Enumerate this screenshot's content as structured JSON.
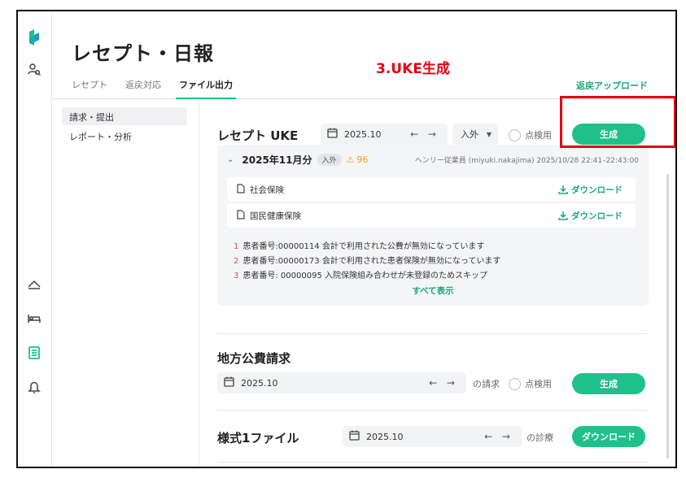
{
  "header": {
    "title": "レセプト・日報",
    "annotation": "3.UKE生成",
    "tabs": [
      {
        "label": "レセプト"
      },
      {
        "label": "返戻対応"
      },
      {
        "label": "ファイル出力"
      }
    ],
    "return_upload": "返戻アップロード"
  },
  "subnav": [
    {
      "label": "請求・提出"
    },
    {
      "label": "レポート・分析"
    }
  ],
  "uke": {
    "title": "レセプト UKE",
    "date": "2025.10",
    "arrows": "← →",
    "type_select": "入外",
    "check_label": "点検用",
    "generate": "生成",
    "panel": {
      "month": "2025年11月分",
      "badge": "入外",
      "warn_count": "96",
      "user": "ヘンリー従業員 (miyuki.nakajima)  2025/10/28 22:41–22:43:00",
      "files": [
        {
          "name": "社会保険",
          "download": "ダウンロード"
        },
        {
          "name": "国民健康保険",
          "download": "ダウンロード"
        }
      ],
      "messages": [
        {
          "num": "1",
          "text": "患者番号:00000114 会計で利用された公費が無効になっています"
        },
        {
          "num": "2",
          "text": "患者番号:00000173 会計で利用された患者保険が無効になっています"
        },
        {
          "num": "3",
          "text": "患者番号: 00000095 入院保険組み合わせが未登録のためスキップ"
        }
      ],
      "show_all": "すべて表示"
    }
  },
  "local": {
    "title": "地方公費請求",
    "date": "2025.10",
    "arrows": "← →",
    "suffix": "の請求",
    "check_label": "点検用",
    "generate": "生成"
  },
  "form1": {
    "title": "様式1ファイル",
    "date": "2025.10",
    "arrows": "← →",
    "suffix": "の診療",
    "download": "ダウンロード"
  },
  "colors": {
    "accent": "#1fc18a",
    "annotation": "#e60012"
  }
}
